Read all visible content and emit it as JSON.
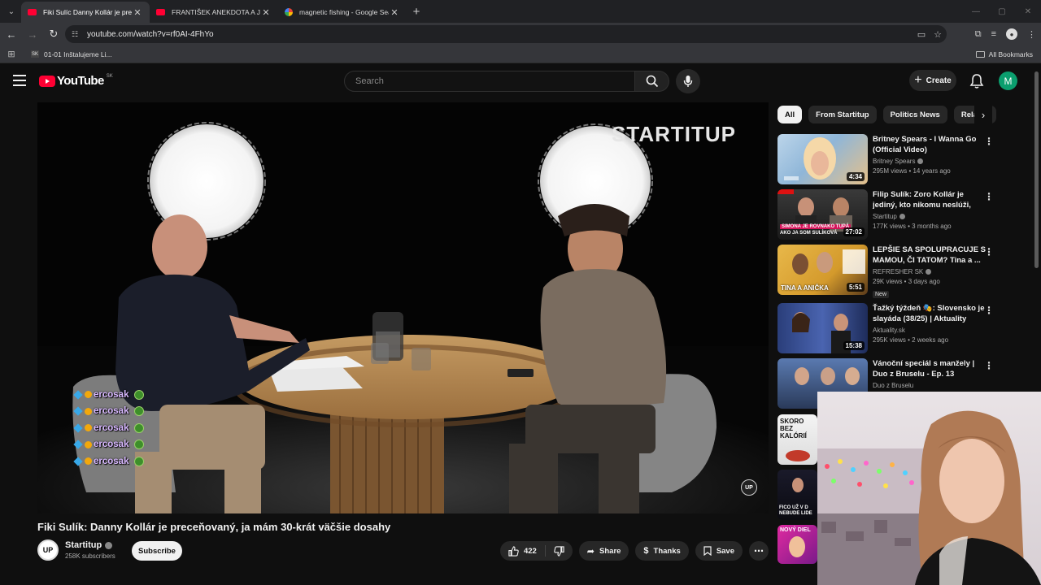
{
  "browser": {
    "tabs": [
      {
        "title": "Fiki Sulíc Danny Kollár je prece...",
        "active": true,
        "favicon": "youtube"
      },
      {
        "title": "FRANTIŠEK ANEKDOTA A JEHO...",
        "active": false,
        "favicon": "youtube"
      },
      {
        "title": "magnetic fishing - Google Sear...",
        "active": false,
        "favicon": "google"
      }
    ],
    "url": "youtube.com/watch?v=rf0AI-4FhYo",
    "bookmark": {
      "icon_text": "SK",
      "label": "01-01 Inštalujeme Li..."
    },
    "all_bookmarks": "All Bookmarks"
  },
  "yt": {
    "logo_text": "YouTube",
    "country_code": "SK",
    "search_placeholder": "Search",
    "create_label": "Create",
    "avatar_letter": "M"
  },
  "video": {
    "title": "Fiki Sulík: Danny Kollár je preceňovaný, ja mám 30-krát väčšie dosahy",
    "watermark": "STARTITUP",
    "badge": "UP",
    "chat_name": "ercosak",
    "channel": {
      "name": "Startitup",
      "avatar_text": "UP",
      "subscribers": "258K subscribers"
    },
    "subscribe_label": "Subscribe",
    "likes": "422",
    "share_label": "Share",
    "thanks_label": "Thanks",
    "save_label": "Save"
  },
  "chips": [
    "All",
    "From Startitup",
    "Politics News",
    "Related"
  ],
  "recommendations": [
    {
      "title": "Britney Spears - I Wanna Go (Official Video)",
      "channel": "Britney Spears",
      "verified": true,
      "stats": "295M views • 14 years ago",
      "duration": "4:34",
      "new": false
    },
    {
      "title": "Filip Sulík: Zoro Kollár je jediný, kto nikomu neslúži, peniaze h...",
      "channel": "Startitup",
      "verified": true,
      "stats": "177K views • 3 months ago",
      "duration": "27:02",
      "new": false
    },
    {
      "title": "LEPŠIE SA SPOLUPRACUJE S MAMOU, ČI TATOM? Tina a ...",
      "channel": "REFRESHER SK",
      "verified": true,
      "stats": "29K views • 3 days ago",
      "duration": "5:51",
      "new": true,
      "new_label": "New"
    },
    {
      "title": "Ťažký týždeň 🎭: Slovensko je slayáda (38/25) | Aktuality",
      "channel": "Aktuality.sk",
      "verified": false,
      "stats": "295K views • 2 weeks ago",
      "duration": "15:38",
      "new": false
    },
    {
      "title": "Vánoční speciál s manžely | Duo z Bruselu - Ep. 13",
      "channel": "Duo z Bruselu",
      "verified": false,
      "stats": "",
      "duration": "",
      "new": false
    }
  ],
  "thumb_texts": {
    "t2_top": "SIMONA JE ROVNAKO TUPÁ",
    "t2_bottom": "AKO JA SOM SULÍKOVÁ",
    "t3": "TINA A ANIČKA",
    "t6": "SKORO BEZ KALÓRIÍ",
    "t7": "FICO UŽ V D NEBUDE LIDE",
    "t8": "NOVÝ DIEL"
  }
}
